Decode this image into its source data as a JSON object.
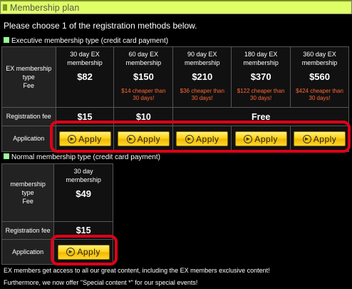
{
  "title": "Membership plan",
  "intro": "Please choose 1 of the registration methods below.",
  "ex_section": {
    "heading": "Executive membership type (credit card payment)",
    "label_line1": "EX membership",
    "label_line2": "type",
    "label_line3": "Fee",
    "plans": [
      {
        "line1": "30 day EX",
        "line2": "membership",
        "price": "$82",
        "saving1": "",
        "saving2": ""
      },
      {
        "line1": "60 day EX",
        "line2": "membership",
        "price": "$150",
        "saving1": "$14 cheaper than",
        "saving2": "30 days!"
      },
      {
        "line1": "90 day EX",
        "line2": "membership",
        "price": "$210",
        "saving1": "$36 cheaper than",
        "saving2": "30 days!"
      },
      {
        "line1": "180 day EX",
        "line2": "membership",
        "price": "$370",
        "saving1": "$122 cheaper than",
        "saving2": "30 days!"
      },
      {
        "line1": "360 day EX",
        "line2": "membership",
        "price": "$560",
        "saving1": "$424 cheaper than",
        "saving2": "30 days!"
      }
    ],
    "reg_fee_label": "Registration fee",
    "reg_fees": [
      "$15",
      "$10",
      "Free"
    ],
    "application_label": "Application"
  },
  "normal_section": {
    "heading": "Normal membership type (credit card payment)",
    "label_line1": "membership",
    "label_line2": "type",
    "label_line3": "Fee",
    "plan_line1": "30 day",
    "plan_line2": "membership",
    "price": "$49",
    "reg_fee_label": "Registration fee",
    "reg_fee": "$15",
    "application_label": "Application"
  },
  "apply_label": "Apply",
  "footer_line1": "EX members get access to all our great content, including the EX members exclusive content!",
  "footer_line2": "Furthermore, we now offer \"Special content *\" for our special events!",
  "colors": {
    "title_bar": "#dfff66",
    "highlight": "#e00018",
    "button": "#ffd21a",
    "saving_text": "#ff6633"
  }
}
